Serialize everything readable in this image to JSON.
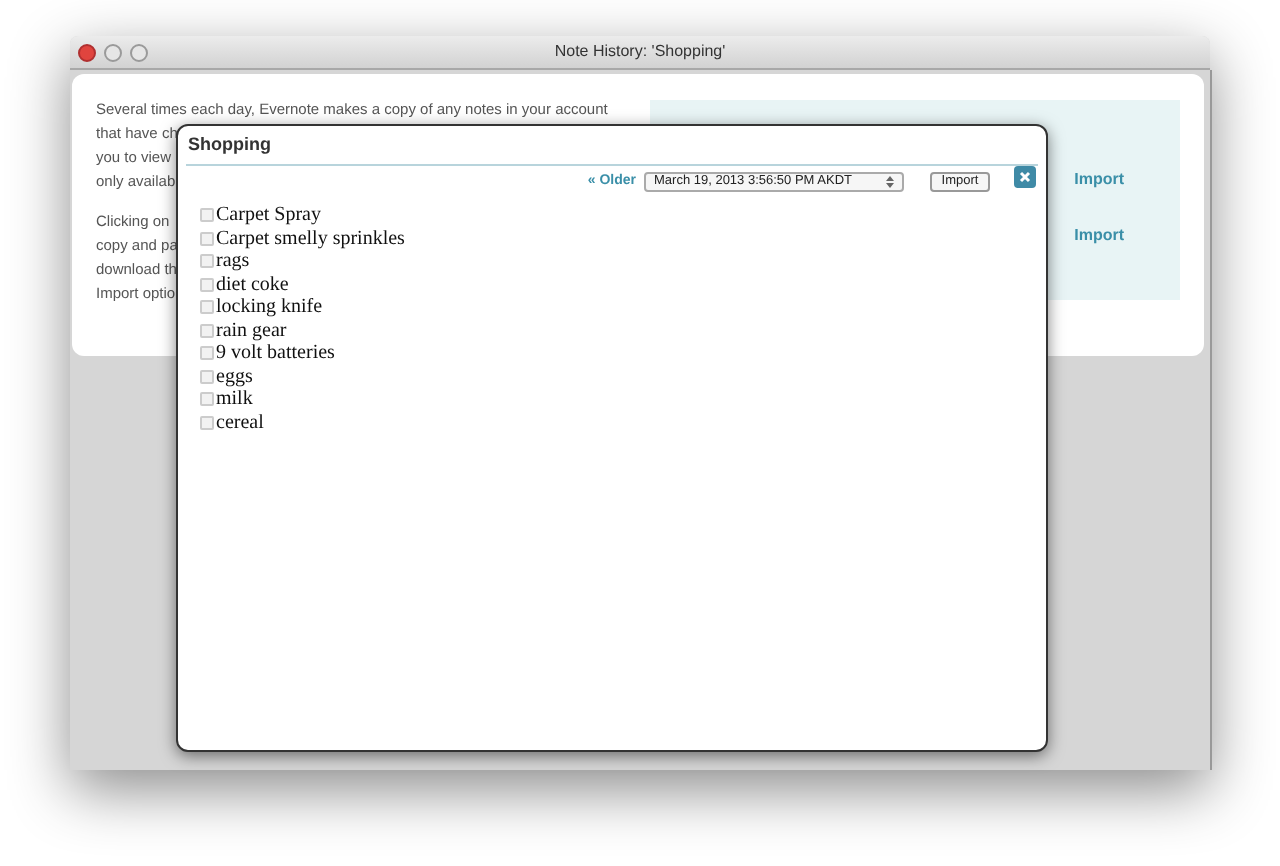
{
  "window": {
    "title": "Note History: 'Shopping'"
  },
  "background": {
    "paragraphs": [
      [
        "Several times each day, Evernote makes a copy of any notes in your account",
        "that have ch",
        "you to view",
        "only availab"
      ],
      [
        "Clicking on",
        "copy and pa",
        "download th",
        "Import optio"
      ]
    ],
    "import_links": [
      "Import",
      "Import"
    ]
  },
  "dialog": {
    "title": "Shopping",
    "older_link": "« Older",
    "version": "March 19, 2013 3:56:50 PM AKDT",
    "import_button": "Import",
    "items": [
      {
        "text": "Carpet Spray",
        "checked": false
      },
      {
        "text": "Carpet smelly sprinkles",
        "checked": false
      },
      {
        "text": "rags",
        "checked": false
      },
      {
        "text": "diet coke",
        "checked": false
      },
      {
        "text": "locking knife",
        "checked": false
      },
      {
        "text": "rain gear",
        "checked": false
      },
      {
        "text": "9 volt batteries",
        "checked": false
      },
      {
        "text": "eggs",
        "checked": false
      },
      {
        "text": "milk",
        "checked": false
      },
      {
        "text": "cereal",
        "checked": false
      }
    ]
  }
}
